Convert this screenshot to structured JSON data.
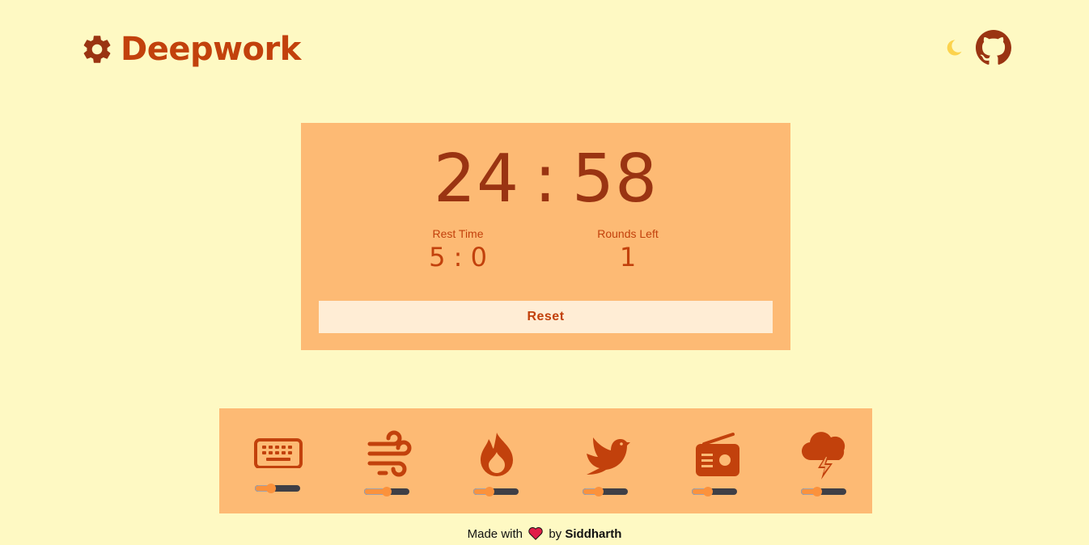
{
  "header": {
    "title": "Deepwork",
    "logo_icon": "gear-icon",
    "theme_toggle_icon": "moon-icon",
    "repo_icon": "github-icon",
    "colors": {
      "brand": "#c2410c",
      "moon": "#fcd34d",
      "background": "#fef9c3"
    }
  },
  "timer": {
    "minutes": "24",
    "separator": ":",
    "seconds": "58",
    "rest_label": "Rest Time",
    "rest_value": "5 : 0",
    "rounds_label": "Rounds Left",
    "rounds_value": "1",
    "reset_label": "Reset",
    "colors": {
      "card": "#fdba74",
      "digits": "#9a3412",
      "button": "#ffedd5"
    }
  },
  "sounds": [
    {
      "icon": "keyboard-icon",
      "volume": 0.35
    },
    {
      "icon": "wind-icon",
      "volume": 0.5
    },
    {
      "icon": "fire-icon",
      "volume": 0.35
    },
    {
      "icon": "bird-icon",
      "volume": 0.35
    },
    {
      "icon": "radio-icon",
      "volume": 0.35
    },
    {
      "icon": "thunderstorm-icon",
      "volume": 0.35
    }
  ],
  "footer": {
    "prefix": "Made with",
    "heart_icon": "heart-icon",
    "by": "by",
    "author": "Siddharth"
  }
}
